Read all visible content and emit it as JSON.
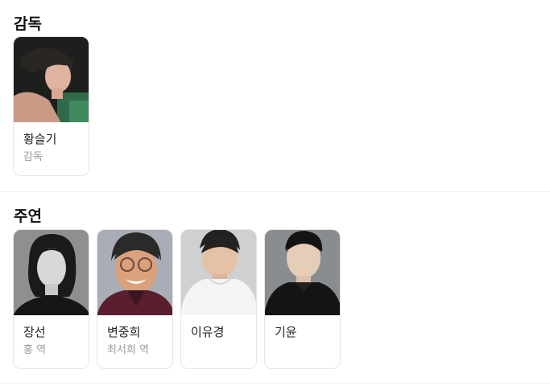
{
  "directors": {
    "title": "감독",
    "people": [
      {
        "name": "황슬기",
        "role": "감독"
      }
    ]
  },
  "cast": {
    "title": "주연",
    "people": [
      {
        "name": "장선",
        "role": "홍 역"
      },
      {
        "name": "변중희",
        "role": "최서희 역"
      },
      {
        "name": "이유경",
        "role": ""
      },
      {
        "name": "기윤",
        "role": ""
      }
    ]
  }
}
